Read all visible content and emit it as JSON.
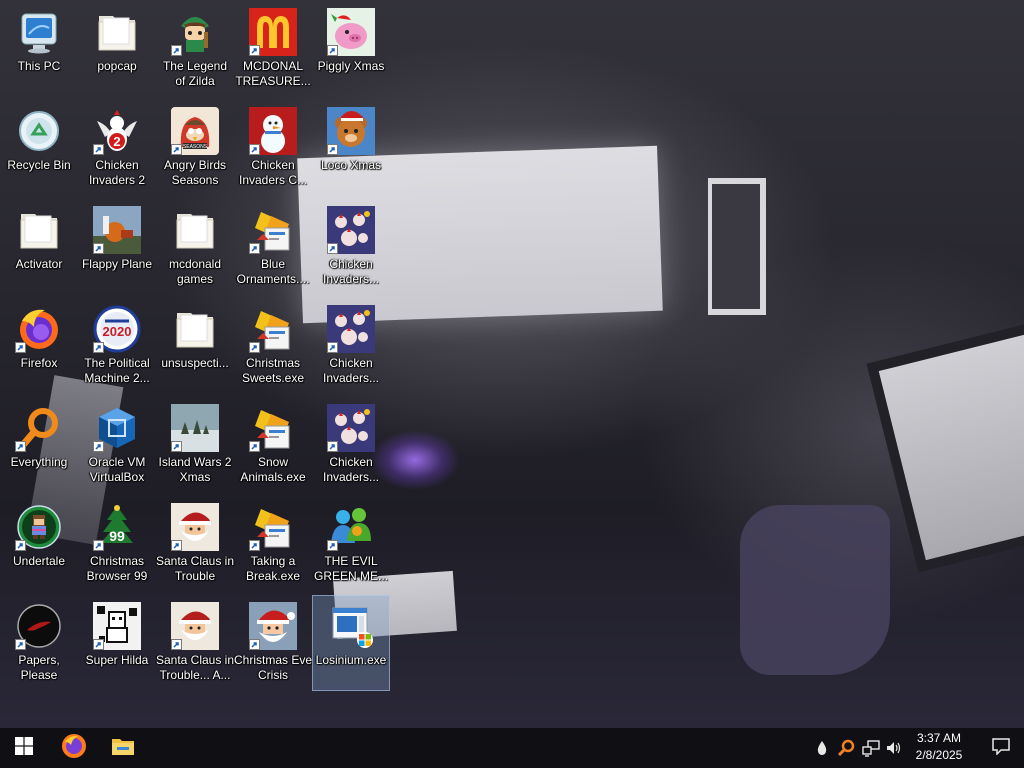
{
  "desktop": {
    "icons": [
      {
        "label": "This PC",
        "icon": "this-pc-icon"
      },
      {
        "label": "Recycle Bin",
        "icon": "recycle-bin-icon"
      },
      {
        "label": "Activator",
        "icon": "folder-icon"
      },
      {
        "label": "Firefox",
        "icon": "firefox-icon"
      },
      {
        "label": "Everything",
        "icon": "everything-search-icon"
      },
      {
        "label": "Undertale",
        "icon": "undertale-icon"
      },
      {
        "label": "Papers, Please",
        "icon": "papers-please-icon"
      },
      {
        "label": "popcap",
        "icon": "folder-icon"
      },
      {
        "label": "Chicken\nInvaders 2",
        "icon": "chicken-invaders-2-icon"
      },
      {
        "label": "Flappy Plane",
        "icon": "flappy-plane-icon"
      },
      {
        "label": "The Political\nMachine 2...",
        "icon": "political-machine-icon"
      },
      {
        "label": "Oracle VM\nVirtualBox",
        "icon": "virtualbox-icon"
      },
      {
        "label": "Christmas\nBrowser 99",
        "icon": "christmas-tree-icon"
      },
      {
        "label": "Super Hilda",
        "icon": "super-hilda-icon"
      },
      {
        "label": "The Legend\nof Zilda",
        "icon": "zilda-character-icon"
      },
      {
        "label": "Angry Birds\nSeasons",
        "icon": "angry-birds-icon"
      },
      {
        "label": "mcdonald\ngames",
        "icon": "folder-icon"
      },
      {
        "label": "unsuspecti...",
        "icon": "folder-icon"
      },
      {
        "label": "Island Wars 2\nXmas",
        "icon": "island-wars-icon"
      },
      {
        "label": "Santa Claus in\nTrouble",
        "icon": "santa-trouble-icon"
      },
      {
        "label": "Santa Claus in\nTrouble... A...",
        "icon": "santa-trouble-icon"
      },
      {
        "label": "MCDONAL\nTREASURE...",
        "icon": "mcdonalds-icon"
      },
      {
        "label": "Chicken\nInvaders C...",
        "icon": "snowman-icon"
      },
      {
        "label": "Blue\nOrnaments....",
        "icon": "installer-icon"
      },
      {
        "label": "Christmas\nSweets.exe",
        "icon": "installer-icon"
      },
      {
        "label": "Snow\nAnimals.exe",
        "icon": "installer-icon"
      },
      {
        "label": "Taking a\nBreak.exe",
        "icon": "installer-icon"
      },
      {
        "label": "Christmas Eve\nCrisis",
        "icon": "santa-face-icon"
      },
      {
        "label": "Piggly Xmas",
        "icon": "pig-icon"
      },
      {
        "label": "Loco Xmas",
        "icon": "teddy-bear-icon"
      },
      {
        "label": "Chicken\nInvaders...",
        "icon": "chicken-invaders-icon"
      },
      {
        "label": "Chicken\nInvaders...",
        "icon": "chicken-invaders-icon"
      },
      {
        "label": "Chicken\nInvaders...",
        "icon": "chicken-invaders-icon"
      },
      {
        "label": "THE EVIL\nGREEN ME...",
        "icon": "messenger-people-icon"
      },
      {
        "label": "Losinium.exe",
        "icon": "losinium-app-icon"
      }
    ]
  },
  "taskbar": {
    "start": {
      "icon": "windows-start-icon"
    },
    "pinned": [
      {
        "icon": "firefox-icon"
      },
      {
        "icon": "file-explorer-icon"
      }
    ],
    "tray": [
      {
        "icon": "water-drop-icon"
      },
      {
        "icon": "everything-search-icon"
      },
      {
        "icon": "network-icon"
      },
      {
        "icon": "volume-icon"
      }
    ],
    "clock": {
      "time": "3:37 AM",
      "date": "2/8/2025"
    },
    "notifications": {
      "icon": "action-center-icon"
    }
  },
  "colors": {
    "taskbar": "#101014",
    "selection": "#82a0c8",
    "label_text": "#ffffff"
  }
}
